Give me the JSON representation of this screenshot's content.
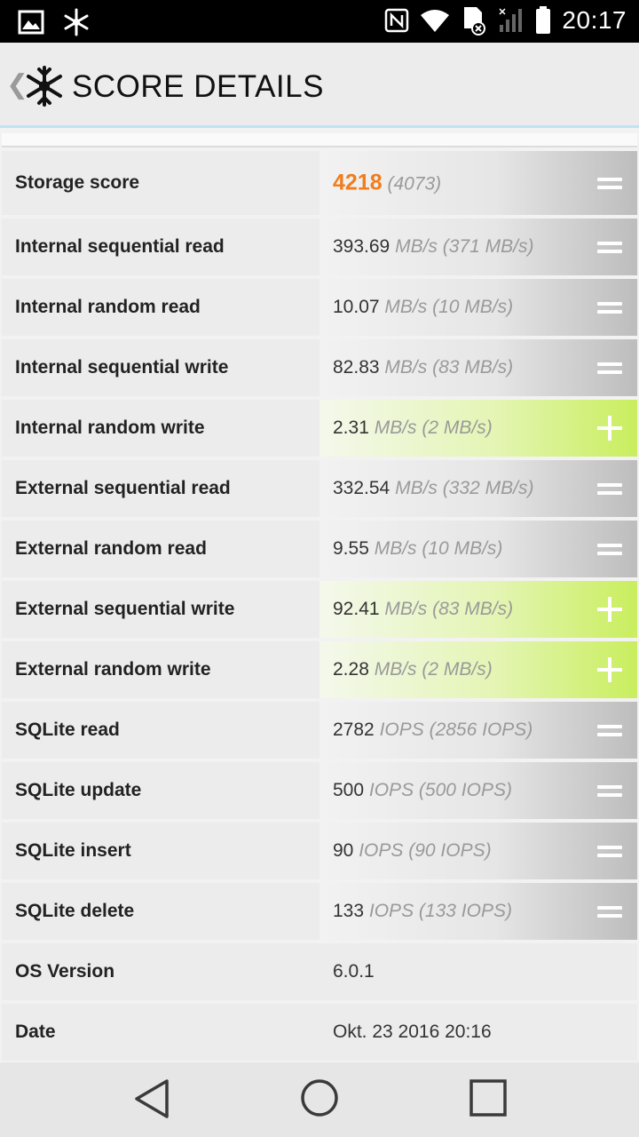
{
  "status_bar": {
    "time": "20:17",
    "icons": [
      "gallery-icon",
      "snowflake-icon",
      "nfc-icon",
      "wifi-icon",
      "no-sim-icon",
      "signal-icon",
      "battery-icon"
    ]
  },
  "header": {
    "title": "SCORE DETAILS",
    "back_glyph": "❮"
  },
  "rows": [
    {
      "label": "Storage score",
      "value": "4218",
      "unit": "(4073)",
      "indicator": "equal",
      "kind": "score"
    },
    {
      "label": "Internal sequential read",
      "value": "393.69",
      "unit": "MB/s (371 MB/s)",
      "indicator": "equal"
    },
    {
      "label": "Internal random read",
      "value": "10.07",
      "unit": "MB/s (10 MB/s)",
      "indicator": "equal"
    },
    {
      "label": "Internal sequential write",
      "value": "82.83",
      "unit": "MB/s (83 MB/s)",
      "indicator": "equal"
    },
    {
      "label": "Internal random write",
      "value": "2.31",
      "unit": "MB/s (2 MB/s)",
      "indicator": "plus"
    },
    {
      "label": "External sequential read",
      "value": "332.54",
      "unit": "MB/s (332 MB/s)",
      "indicator": "equal"
    },
    {
      "label": "External random read",
      "value": "9.55",
      "unit": "MB/s (10 MB/s)",
      "indicator": "equal"
    },
    {
      "label": "External sequential write",
      "value": "92.41",
      "unit": "MB/s (83 MB/s)",
      "indicator": "plus"
    },
    {
      "label": "External random write",
      "value": "2.28",
      "unit": "MB/s (2 MB/s)",
      "indicator": "plus"
    },
    {
      "label": "SQLite read",
      "value": "2782",
      "unit": "IOPS (2856 IOPS)",
      "indicator": "equal"
    },
    {
      "label": "SQLite update",
      "value": "500",
      "unit": "IOPS (500 IOPS)",
      "indicator": "equal"
    },
    {
      "label": "SQLite insert",
      "value": "90",
      "unit": "IOPS (90 IOPS)",
      "indicator": "equal"
    },
    {
      "label": "SQLite delete",
      "value": "133",
      "unit": "IOPS (133 IOPS)",
      "indicator": "equal"
    },
    {
      "label": "OS Version",
      "value": "6.0.1",
      "unit": "",
      "indicator": "none"
    },
    {
      "label": "Date",
      "value": "Okt. 23 2016 20:16",
      "unit": "",
      "indicator": "none"
    }
  ],
  "colors": {
    "score": "#f07d1f",
    "better": "#c9ee5e",
    "neutral": "#bdbdbd",
    "header_border": "#bfe3f3"
  },
  "nav_bar": {
    "icons": [
      "back-triangle-icon",
      "home-circle-icon",
      "recents-square-icon"
    ]
  }
}
